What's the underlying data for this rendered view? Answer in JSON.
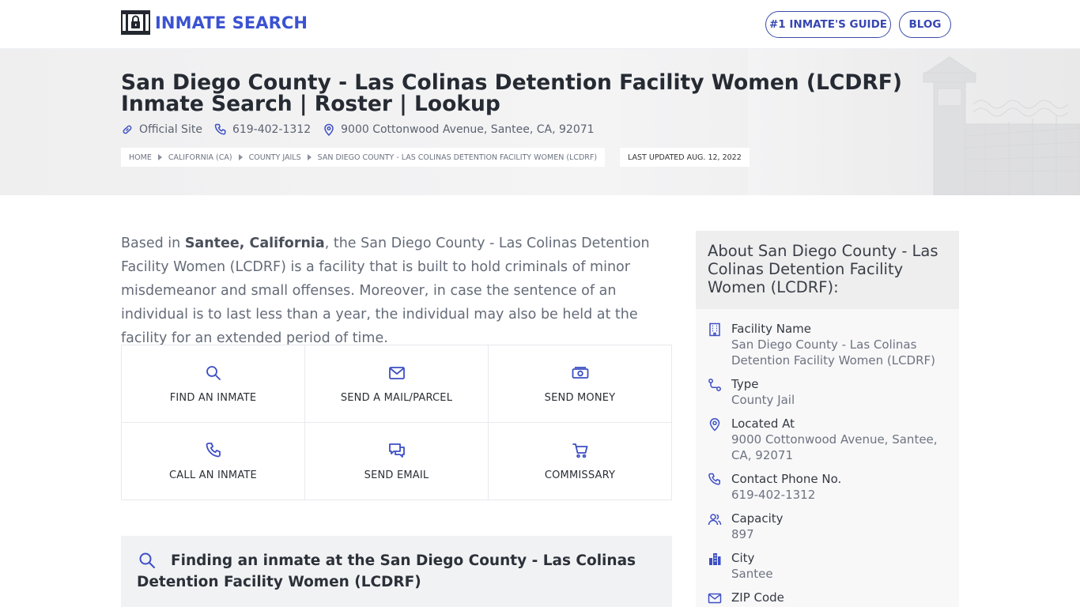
{
  "header": {
    "brand": "INMATE SEARCH",
    "nav": [
      {
        "label": "#1 INMATE'S GUIDE"
      },
      {
        "label": "BLOG"
      }
    ]
  },
  "hero": {
    "title": "San Diego County - Las Colinas Detention Facility Women (LCDRF) Inmate Search | Roster | Lookup",
    "official_site": "Official Site",
    "phone": "619-402-1312",
    "address": "9000 Cottonwood Avenue, Santee, CA, 92071",
    "breadcrumbs": [
      "HOME",
      "CALIFORNIA (CA)",
      "COUNTY JAILS",
      "SAN DIEGO COUNTY - LAS COLINAS DETENTION FACILITY WOMEN (LCDRF)"
    ],
    "last_updated": "LAST UPDATED AUG. 12, 2022"
  },
  "intro": {
    "pre": "Based in ",
    "bold": "Santee, California",
    "post": ", the San Diego County - Las Colinas Detention Facility Women (LCDRF) is a facility that is built to hold criminals of minor misdemeanor and small offenses. Moreover, in case the sentence of an individual is to last less than a year, the individual may also be held at the facility for an extended period of time."
  },
  "services": [
    {
      "label": "FIND AN INMATE",
      "icon": "search-icon"
    },
    {
      "label": "SEND A MAIL/PARCEL",
      "icon": "mail-icon"
    },
    {
      "label": "SEND MONEY",
      "icon": "money-icon"
    },
    {
      "label": "CALL AN INMATE",
      "icon": "phone-icon"
    },
    {
      "label": "SEND EMAIL",
      "icon": "chat-icon"
    },
    {
      "label": "COMMISSARY",
      "icon": "cart-icon"
    }
  ],
  "finding": {
    "title": "Finding an inmate at the San Diego County - Las Colinas Detention Facility Women (LCDRF)"
  },
  "sidebar": {
    "title": "About San Diego County - Las Colinas Detention Facility Women (LCDRF):",
    "items": [
      {
        "label": "Facility Name",
        "value": "San Diego County - Las Colinas Detention Facility Women (LCDRF)",
        "icon": "building-icon"
      },
      {
        "label": "Type",
        "value": "County Jail",
        "icon": "route-icon"
      },
      {
        "label": "Located At",
        "value": "9000 Cottonwood Avenue, Santee, CA, 92071",
        "icon": "map-pin-icon"
      },
      {
        "label": "Contact Phone No.",
        "value": "619-402-1312",
        "icon": "phone-icon"
      },
      {
        "label": "Capacity",
        "value": "897",
        "icon": "users-icon"
      },
      {
        "label": "City",
        "value": "Santee",
        "icon": "city-icon"
      },
      {
        "label": "ZIP Code",
        "value": "",
        "icon": "mail-icon"
      }
    ]
  },
  "colors": {
    "brand": "#3b52d1",
    "icon": "#3d4fc4",
    "hero_bg": "#f1f1f2",
    "sidebar_bg": "#f8f8f9"
  }
}
